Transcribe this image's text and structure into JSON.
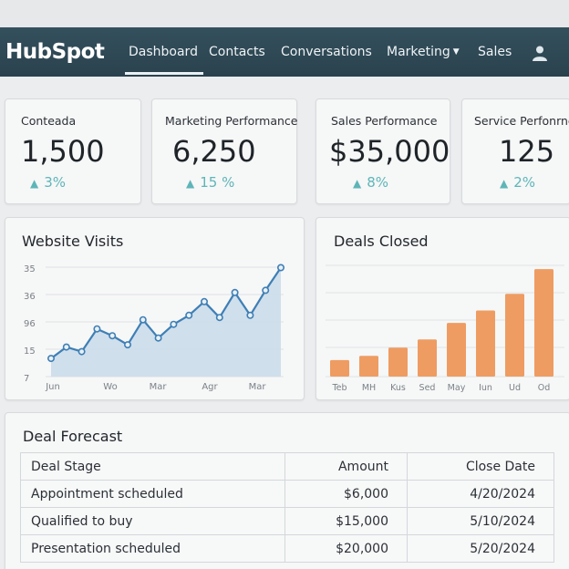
{
  "app": {
    "logo": "HubSpot"
  },
  "nav": {
    "items": [
      {
        "label": "Dashboard",
        "active": true
      },
      {
        "label": "Contacts"
      },
      {
        "label": "Conversations"
      },
      {
        "label": "Marketing",
        "dropdown": true
      },
      {
        "label": "Sales"
      }
    ],
    "user_icon": "user-icon"
  },
  "kpis": [
    {
      "label": "Conteada",
      "value": "1,500",
      "change": "3%",
      "icon": "arrow-up-icon"
    },
    {
      "label": "Marketing Performance",
      "value": "6,250",
      "change": "15 %",
      "icon": "arrow-up-icon"
    },
    {
      "label": "Sales Performance",
      "value": "$35,000",
      "change": "8%",
      "icon": "arrow-up-icon"
    },
    {
      "label": "Service Perfonrnc",
      "value": "125",
      "change": "2%",
      "icon": "arrow-up-icon"
    }
  ],
  "website_visits": {
    "title": "Website Visits",
    "chart_data": {
      "type": "area",
      "y_tick_labels": [
        "35",
        "36",
        "96",
        "15",
        "7"
      ],
      "x_tick_labels": [
        "Jun",
        "Wo",
        "Mar",
        "Agr",
        "Mar"
      ],
      "values": [
        15,
        20,
        18,
        28,
        25,
        21,
        32,
        24,
        30,
        34,
        40,
        33,
        44,
        34,
        45,
        55
      ],
      "y_range": [
        7,
        60
      ],
      "grid": true,
      "colors": {
        "line": "#3e7fb5",
        "fill": "#c9dbea"
      }
    }
  },
  "deals_closed": {
    "title": "Deals Closed",
    "chart_data": {
      "type": "bar",
      "categories": [
        "Teb",
        "MH",
        "Kus",
        "Sed",
        "May",
        "Iun",
        "Ud",
        "Od"
      ],
      "values": [
        8,
        10,
        14,
        18,
        26,
        32,
        40,
        52
      ],
      "y_range": [
        0,
        60
      ],
      "grid": true,
      "colors": {
        "bar": "#ee9c62"
      }
    }
  },
  "deal_forecast": {
    "title": "Deal Forecast",
    "columns": [
      "Deal Stage",
      "Amount",
      "Close Date"
    ],
    "rows": [
      [
        "Appointment scheduled",
        "$6,000",
        "4/20/2024"
      ],
      [
        "Qualified to buy",
        "$15,000",
        "5/10/2024"
      ],
      [
        "Presentation scheduled",
        "$20,000",
        "5/20/2024"
      ]
    ]
  }
}
